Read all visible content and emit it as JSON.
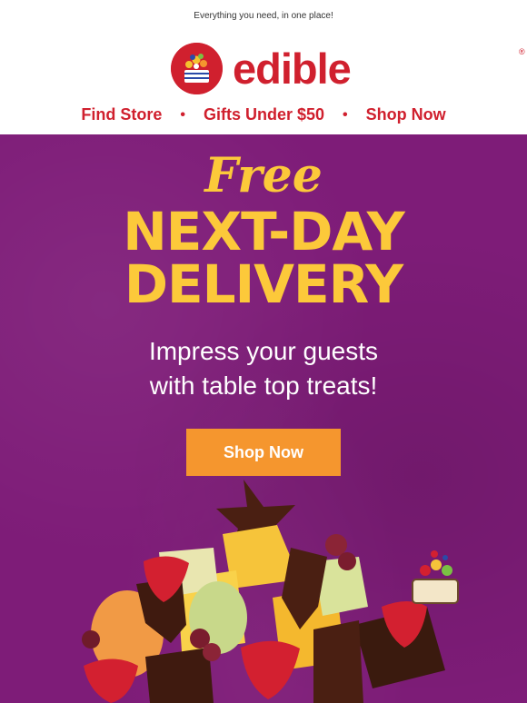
{
  "preheader": "Everything you need, in one place!",
  "brand": {
    "name": "edible",
    "registered": "®",
    "primary_color": "#d0202e"
  },
  "nav": {
    "items": [
      {
        "label": "Find Store"
      },
      {
        "label": "Gifts Under $50"
      },
      {
        "label": "Shop Now"
      }
    ],
    "separator": "•"
  },
  "hero": {
    "background_color": "#7e1c78",
    "accent_color": "#fcc93a",
    "free": "Free",
    "headline_line1": "NEXT-DAY",
    "headline_line2": "DELIVERY",
    "sub_line1": "Impress your guests",
    "sub_line2": "with table top treats!",
    "cta_label": "Shop Now",
    "cta_color": "#f5962e",
    "image_icon": "fruit-arrangement-icon"
  }
}
